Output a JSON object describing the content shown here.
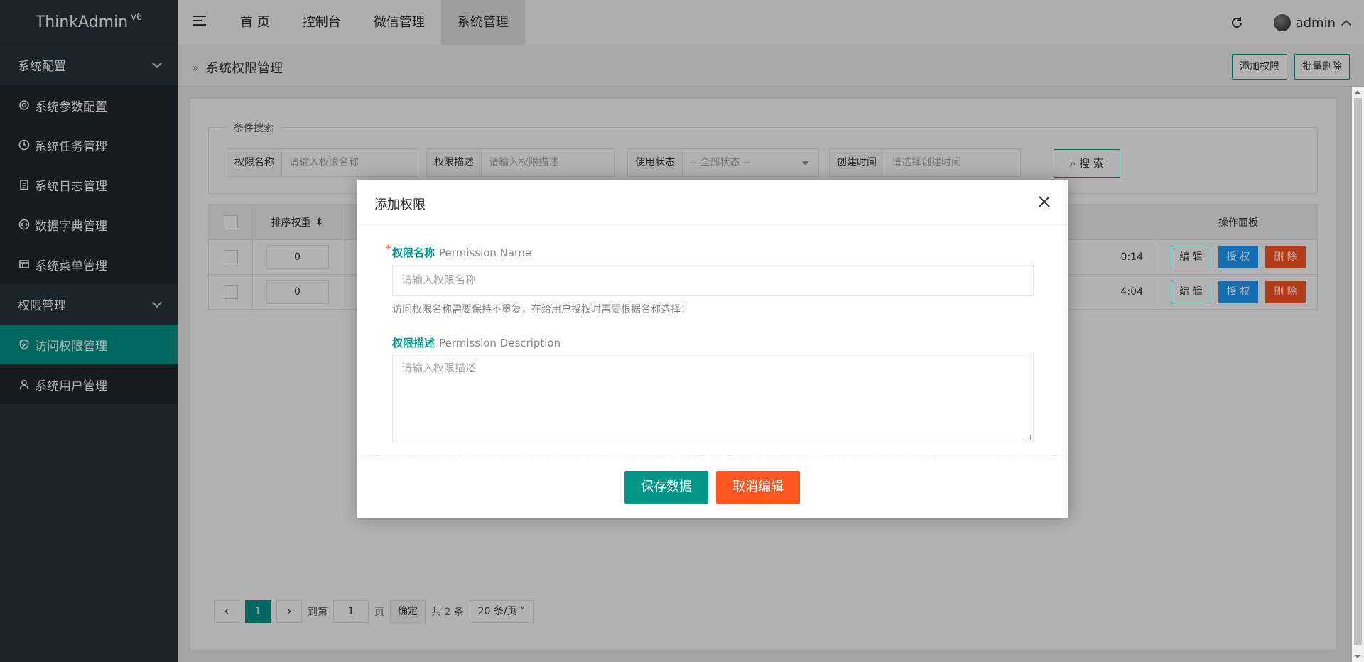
{
  "app": {
    "title": "ThinkAdmin",
    "version": "v6"
  },
  "sidebar": {
    "groups": [
      {
        "label": "系统配置",
        "items": [
          {
            "label": "系统参数配置",
            "icon": "gear-icon"
          },
          {
            "label": "系统任务管理",
            "icon": "clock-icon"
          },
          {
            "label": "系统日志管理",
            "icon": "clipboard-icon"
          },
          {
            "label": "数据字典管理",
            "icon": "code-icon"
          },
          {
            "label": "系统菜单管理",
            "icon": "window-icon"
          }
        ]
      },
      {
        "label": "权限管理",
        "items": [
          {
            "label": "访问权限管理",
            "icon": "shield-icon",
            "active": true
          },
          {
            "label": "系统用户管理",
            "icon": "user-icon"
          }
        ]
      }
    ]
  },
  "topnav": {
    "items": [
      "首 页",
      "控制台",
      "微信管理",
      "系统管理"
    ],
    "active_index": 3,
    "username": "admin"
  },
  "subbar": {
    "breadcrumb": "系统权限管理",
    "add_button": "添加权限",
    "batch_delete_button": "批量删除"
  },
  "search": {
    "legend": "条件搜索",
    "name_label": "权限名称",
    "name_placeholder": "请输入权限名称",
    "desc_label": "权限描述",
    "desc_placeholder": "请输入权限描述",
    "status_label": "使用状态",
    "status_value": "-- 全部状态 --",
    "time_label": "创建时间",
    "time_placeholder": "请选择创建时间",
    "button": "搜 索"
  },
  "table": {
    "headers": {
      "sort": "排序权重",
      "ops": "操作面板"
    },
    "rows": [
      {
        "sort": "0",
        "time_tail": "0:14"
      },
      {
        "sort": "0",
        "time_tail": "4:04"
      }
    ],
    "ops": {
      "edit": "编 辑",
      "auth": "授 权",
      "delete": "删 除"
    }
  },
  "pager": {
    "current": "1",
    "goto_label": "到第",
    "goto_value": "1",
    "page_unit": "页",
    "confirm": "确定",
    "total": "共 2 条",
    "per_page": "20 条/页"
  },
  "modal": {
    "title": "添加权限",
    "name_label_zh": "权限名称",
    "name_label_en": "Permission Name",
    "name_placeholder": "请输入权限名称",
    "name_hint": "访问权限名称需要保持不重复，在给用户授权时需要根据名称选择！",
    "desc_label_zh": "权限描述",
    "desc_label_en": "Permission Description",
    "desc_placeholder": "请输入权限描述",
    "save_button": "保存数据",
    "cancel_button": "取消编辑"
  },
  "colors": {
    "primary": "#009688",
    "danger": "#ff5722",
    "info": "#1e9fff",
    "sidebar": "#28333e"
  }
}
